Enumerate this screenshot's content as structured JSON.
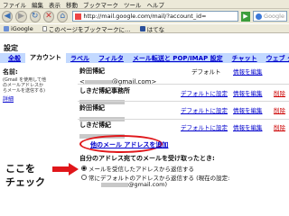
{
  "browser": {
    "menu": [
      "ファイル",
      "編集",
      "表示",
      "移動",
      "ブックマーク",
      "ツール",
      "ヘルプ"
    ],
    "url": "http://mail.google.com/mail/?account_id=",
    "search_placeholder": "Google",
    "bookmarks": [
      "iGoogle",
      "このページをブックマークに…",
      "はてな"
    ]
  },
  "page": {
    "title": "設定",
    "tabs": [
      "全般",
      "アカウント",
      "ラベル",
      "フィルタ",
      "メール転送と POP/IMAP 設定",
      "チャット",
      "ウェブ クリップ"
    ],
    "left": {
      "label": "名前:",
      "description": "(Gmail を使用して他のメールアドレスからメールを送信する)",
      "details_link": "詳細"
    },
    "accounts": [
      {
        "name": "鈴田博紀",
        "email": "@gmail.com>",
        "status": "デフォルト",
        "edit": "情報を編集",
        "delete": ""
      },
      {
        "name": "しきだ博紀事務所",
        "email": "",
        "status": "デフォルトに設定",
        "edit": "情報を編集",
        "delete": "削除"
      },
      {
        "name": "鈴田博紀",
        "email": "",
        "status": "デフォルトに設定",
        "edit": "情報を編集",
        "delete": "削除"
      },
      {
        "name": "しきだ博紀",
        "email": "",
        "status": "デフォルトに設定",
        "edit": "情報を編集",
        "delete": "削除"
      }
    ],
    "add_address": "他のメール アドレスを追加",
    "reply_question": "自分のアドレス宛てのメールを受け取ったとき:",
    "reply_options": [
      "メールを受信したアドレスから返信する",
      "常にデフォルトのアドレスから返信する (現在の設定:"
    ],
    "reply_default_email": "@gmail.com)",
    "annotation": "ここを\nチェック",
    "colors": {
      "annotation_red": "#e0161a",
      "tab_bg": "#c3d9ff",
      "link": "#0000cc"
    }
  }
}
